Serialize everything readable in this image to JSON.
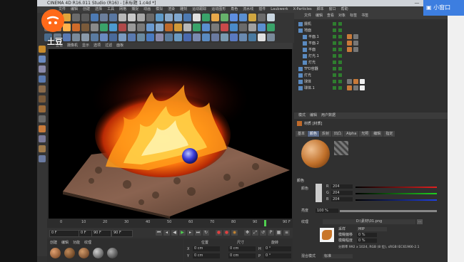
{
  "window": {
    "title": "CINEMA 4D R16.011 Studio (R16) - [未标题 1.c4d *]",
    "controls": [
      "—",
      "□",
      "✕"
    ]
  },
  "overlay": {
    "small_window_label": "小窗口",
    "brand_text": "土豆"
  },
  "menubar": [
    "文件",
    "编辑",
    "创建",
    "选择",
    "工具",
    "网格",
    "捕捉",
    "动画",
    "模拟",
    "渲染",
    "雕刻",
    "运动跟踪",
    "运动图形",
    "角色",
    "流水线",
    "插件",
    "Laubwerk",
    "X-Particles",
    "脚本",
    "窗口",
    "帮助"
  ],
  "toolbar_rows": [
    [
      "#3a5e8a",
      "#c88b2c",
      "#dfa53b",
      "#6b6b6b",
      "#5a5a5a",
      "#4d7ab3",
      "#6c7f9c",
      "#5977a1",
      "#b8b8b8",
      "#c8c8c8",
      "#a8a8a8",
      "#6a6a6a",
      "#5f9ac8",
      "#8aa9c9",
      "#7fa7cf",
      "#4d7ab3",
      "#e0e0e0",
      "#3aa36a",
      "#e8a84a",
      "#66b26b",
      "#5e8ee0",
      "#5a8fd0",
      "#d0a640",
      "#6b6b6b",
      "#c9d6e0"
    ],
    [
      "#6a6a6a",
      "#d07a3a",
      "#ffb24a",
      "#d06b2a",
      "#7a5a3a",
      "#8a8a8a",
      "#3aa36a",
      "#4d9ad0",
      "#b04a4a",
      "#9a9a9a",
      "#7a7a7a",
      "#6a9ad0",
      "#8aa9c9",
      "#c06a2a",
      "#d09a3a",
      "#b8b8b8",
      "#3aa36a",
      "#5a8fd0",
      "#7a7a7a",
      "#c84a4a",
      "#4a8ac8",
      "#6a6a6a",
      "#a0a0a0",
      "#5a8fd0",
      "#3aa36a"
    ],
    [
      "#4a6a8a",
      "#6a7a8a",
      "#5a7ab3",
      "#7a8a9a",
      "#8a9aaa",
      "#5a7aa0",
      "#6a8ac0",
      "#4a6a9a",
      "#7a9ac0",
      "#5a7ab0",
      "#6a8aa0",
      "#4a7ac0",
      "#8a8aaa",
      "#5a7a9a",
      "#6a9ac0",
      "#4a6ab0",
      "#7a8ab0",
      "#5a8ac0",
      "#6a7aa0",
      "#7a9ab0",
      "#5a7ac0",
      "#6a8ab0",
      "#4a7aa0",
      "#e0e0e0",
      "#7a8a9a"
    ]
  ],
  "viewport_menu": [
    "查看",
    "摄像机",
    "显示",
    "选项",
    "过滤",
    "面板"
  ],
  "timeline": {
    "ticks": [
      "0",
      "10",
      "20",
      "30",
      "40",
      "50",
      "60",
      "70",
      "80",
      "90"
    ],
    "end_label": "90 F"
  },
  "transport": {
    "start_field": "0 F",
    "current_field": "0 F",
    "end_field": "90 F",
    "end_field2": "90 F"
  },
  "material_manager": {
    "menu": [
      "创建",
      "编辑",
      "功能",
      "纹理"
    ]
  },
  "coordinates": {
    "headers": [
      "位置",
      "尺寸",
      "旋转"
    ],
    "rows": [
      {
        "axis": "X",
        "pos": "0 cm",
        "size": "0 cm",
        "rot_label": "H",
        "rot": "0 °"
      },
      {
        "axis": "Y",
        "pos": "0 cm",
        "size": "0 cm",
        "rot_label": "P",
        "rot": "0 °"
      }
    ]
  },
  "object_manager": {
    "menu": [
      "文件",
      "编辑",
      "查看",
      "对象",
      "标签",
      "书签"
    ],
    "objects": [
      {
        "name": "摄机",
        "depth": 0
      },
      {
        "name": "地面",
        "depth": 0
      },
      {
        "name": "平面.1",
        "depth": 1
      },
      {
        "name": "平面.2",
        "depth": 1
      },
      {
        "name": "平面",
        "depth": 1
      },
      {
        "name": "灯光.1",
        "depth": 1
      },
      {
        "name": "灯光",
        "depth": 1
      },
      {
        "name": "TFD容器",
        "depth": 0
      },
      {
        "name": "灯光",
        "depth": 0
      },
      {
        "name": "球体",
        "depth": 0
      },
      {
        "name": "球体.1",
        "depth": 0
      }
    ]
  },
  "attributes": {
    "menu": [
      "模式",
      "编辑",
      "用户数据"
    ],
    "material_title": "材质 [材质]",
    "tabs": [
      "基本",
      "颜色",
      "反射",
      "凹凸",
      "Alpha",
      "光照",
      "编辑",
      "指定"
    ],
    "active_tab": "颜色",
    "color_section": "颜色",
    "color_label": "颜色",
    "rgb": [
      {
        "ch": "R",
        "val": "204"
      },
      {
        "ch": "G",
        "val": "204"
      },
      {
        "ch": "B",
        "val": "204"
      }
    ],
    "brightness_label": "亮度",
    "brightness_value": "100 %",
    "texture_label": "纹理",
    "texture_file": "D:\\素材\\01.png",
    "sampling_label": "采样",
    "sampling_value": "MIP",
    "blur_offset_label": "模糊偏移",
    "blur_offset_value": "0 %",
    "blur_scale_label": "模糊程度",
    "blur_scale_value": "0 %",
    "resolution_text": "分辨率 992 x 1024, RGB (8 位), sRGB IEC61966-2.1",
    "mix_mode_label": "混合模式",
    "mix_mode_value": "标准"
  }
}
